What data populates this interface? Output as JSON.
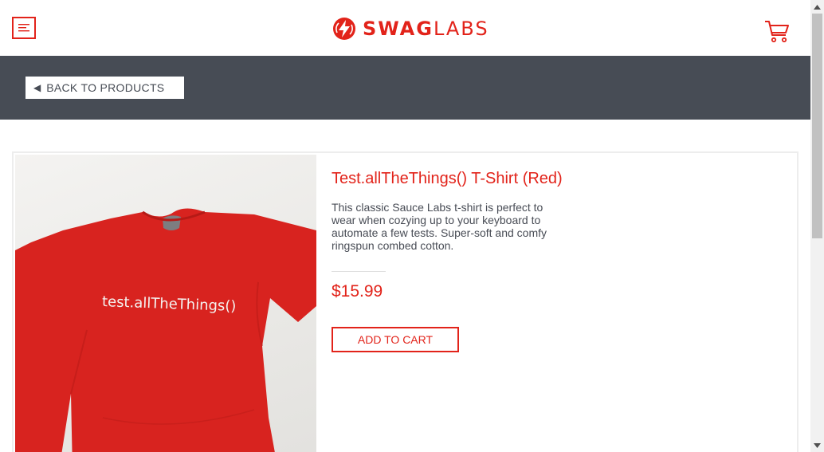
{
  "header": {
    "brand_bold": "SWAG",
    "brand_light": "LABS",
    "colors": {
      "accent": "#e2231a",
      "bar": "#474c55"
    },
    "icons": {
      "menu": "hamburger-menu-icon",
      "logo": "sauce-logo-icon",
      "cart": "shopping-cart-icon"
    }
  },
  "subbar": {
    "back_label": "BACK TO PRODUCTS",
    "back_icon": "caret-left-icon"
  },
  "product": {
    "title": "Test.allTheThings() T-Shirt (Red)",
    "description": "This classic Sauce Labs t-shirt is perfect to wear when cozying up to your keyboard to automate a few tests. Super-soft and comfy ringspun combed cotton.",
    "price": "$15.99",
    "add_to_cart_label": "ADD TO CART",
    "image": {
      "shirt_text": "test.allTheThings()",
      "shirt_color": "#d8231f"
    }
  }
}
